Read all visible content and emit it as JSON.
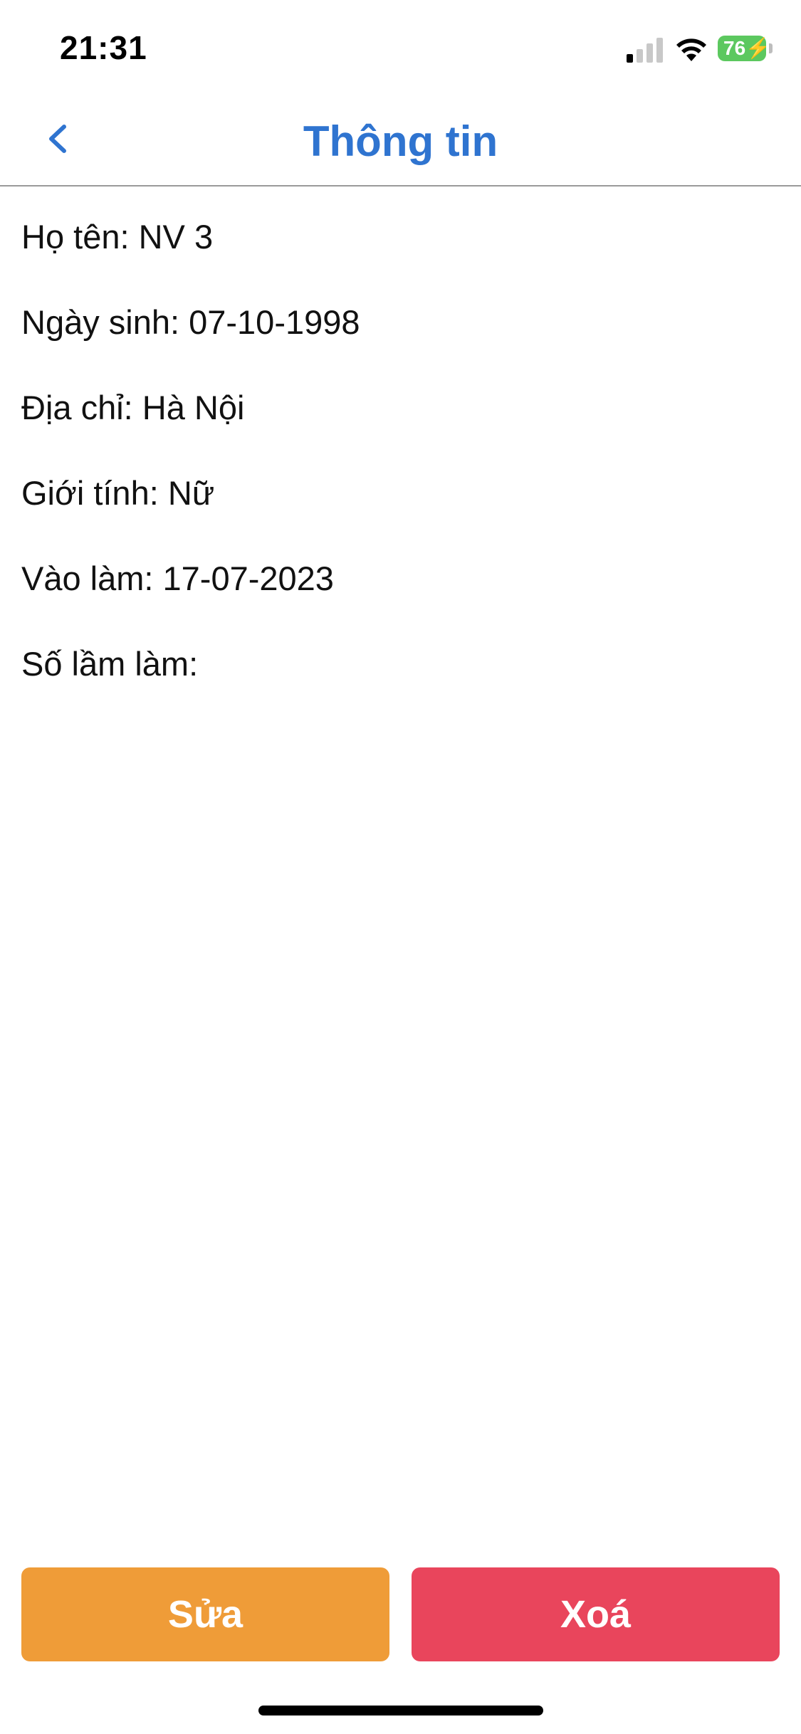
{
  "status_bar": {
    "time": "21:31",
    "battery": "76",
    "signal_icon": "cellular-signal-icon",
    "wifi_icon": "wifi-icon",
    "battery_icon": "battery-charging-icon"
  },
  "header": {
    "title": "Thông tin",
    "back_icon": "chevron-left-icon"
  },
  "info": {
    "name": "Họ tên: NV 3",
    "birthday": "Ngày sinh: 07-10-1998",
    "address": "Địa chỉ: Hà Nội",
    "gender": "Giới tính: Nữ",
    "start_date": "Vào làm: 17-07-2023",
    "mistakes": "Số lầm làm:"
  },
  "actions": {
    "edit_label": "Sửa",
    "delete_label": "Xoá"
  },
  "colors": {
    "title_blue": "#2f74d0",
    "edit_orange": "#ef9c38",
    "delete_red": "#e9455c",
    "battery_green": "#5cc85f"
  }
}
